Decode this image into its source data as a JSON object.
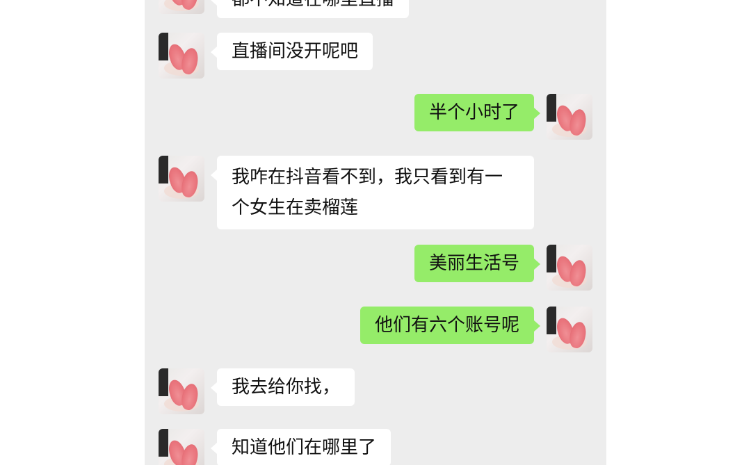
{
  "chat": {
    "messages": [
      {
        "side": "left",
        "text": "都不知道在哪里直播"
      },
      {
        "side": "left",
        "text": "直播间没开呢吧"
      },
      {
        "side": "right",
        "text": "半个小时了"
      },
      {
        "side": "left",
        "text": "我咋在抖音看不到，我只看到有一个女生在卖榴莲"
      },
      {
        "side": "right",
        "text": "美丽生活号"
      },
      {
        "side": "right",
        "text": "他们有六个账号呢"
      },
      {
        "side": "left",
        "text": "我去给你找，"
      },
      {
        "side": "left",
        "text": "知道他们在哪里了"
      }
    ]
  },
  "colors": {
    "chat_background": "#ededed",
    "incoming_bubble": "#ffffff",
    "outgoing_bubble": "#95ec69"
  },
  "icons": {
    "avatar": "avatar-photo-feet"
  }
}
